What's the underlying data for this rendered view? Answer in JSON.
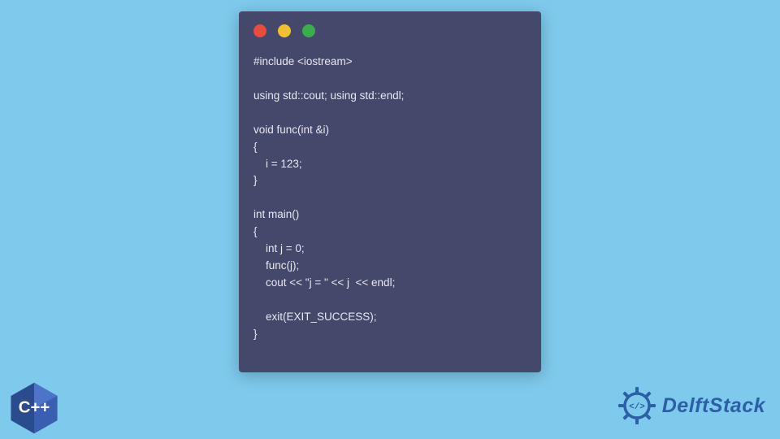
{
  "code_lines": [
    "#include <iostream>",
    "",
    "using std::cout; using std::endl;",
    "",
    "void func(int &i)",
    "{",
    "    i = 123;",
    "}",
    "",
    "int main()",
    "{",
    "    int j = 0;",
    "    func(j);",
    "    cout << \"j = \" << j  << endl;",
    "",
    "    exit(EXIT_SUCCESS);",
    "}"
  ],
  "cpp_badge_label": "C++",
  "brand": "DelftStack"
}
